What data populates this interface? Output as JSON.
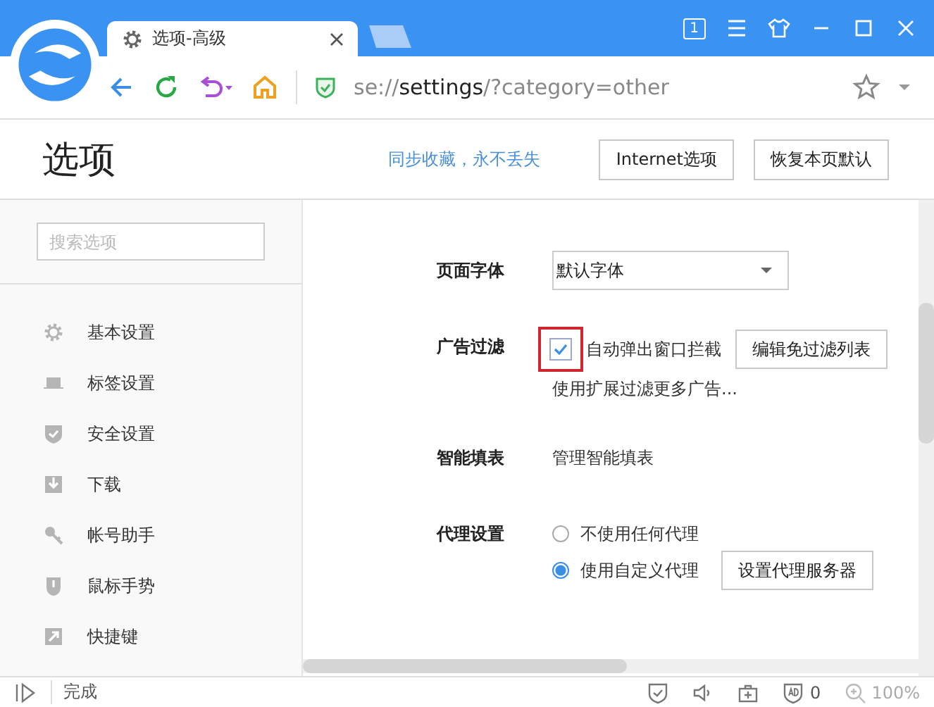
{
  "tab": {
    "title": "选项-高级",
    "selected": true
  },
  "toolbar": {
    "window_count": "1"
  },
  "address": {
    "scheme": "se://",
    "host": "settings",
    "path": "/?category=other"
  },
  "header": {
    "title": "选项",
    "sync_link": "同步收藏，永不丢失",
    "buttons": [
      "Internet选项",
      "恢复本页默认"
    ]
  },
  "sidebar": {
    "search": {
      "placeholder": "搜索选项"
    },
    "items": [
      {
        "label": "基本设置",
        "selected": false
      },
      {
        "label": "标签设置",
        "selected": false
      },
      {
        "label": "安全设置",
        "selected": false
      },
      {
        "label": "下载",
        "selected": false
      },
      {
        "label": "帐号助手",
        "selected": false
      },
      {
        "label": "鼠标手势",
        "selected": false
      },
      {
        "label": "快捷键",
        "selected": false
      }
    ]
  },
  "settings": [
    {
      "kind": "select",
      "label": "页面字体",
      "value": "默认字体"
    },
    {
      "kind": "checkbox",
      "label": "广告过滤",
      "option": "自动弹出窗口拦截",
      "checked": true,
      "highlighted": true,
      "button": "编辑免过滤列表",
      "link": "使用扩展过滤更多广告..."
    },
    {
      "kind": "link",
      "label": "智能填表",
      "link": "管理智能填表"
    },
    {
      "kind": "radio",
      "label": "代理设置",
      "options": [
        {
          "label": "不使用任何代理",
          "selected": false
        },
        {
          "label": "使用自定义代理",
          "selected": true
        }
      ],
      "button": "设置代理服务器"
    }
  ],
  "status_bar": {
    "text": "完成",
    "ad_count": "0",
    "zoom": "100%"
  }
}
